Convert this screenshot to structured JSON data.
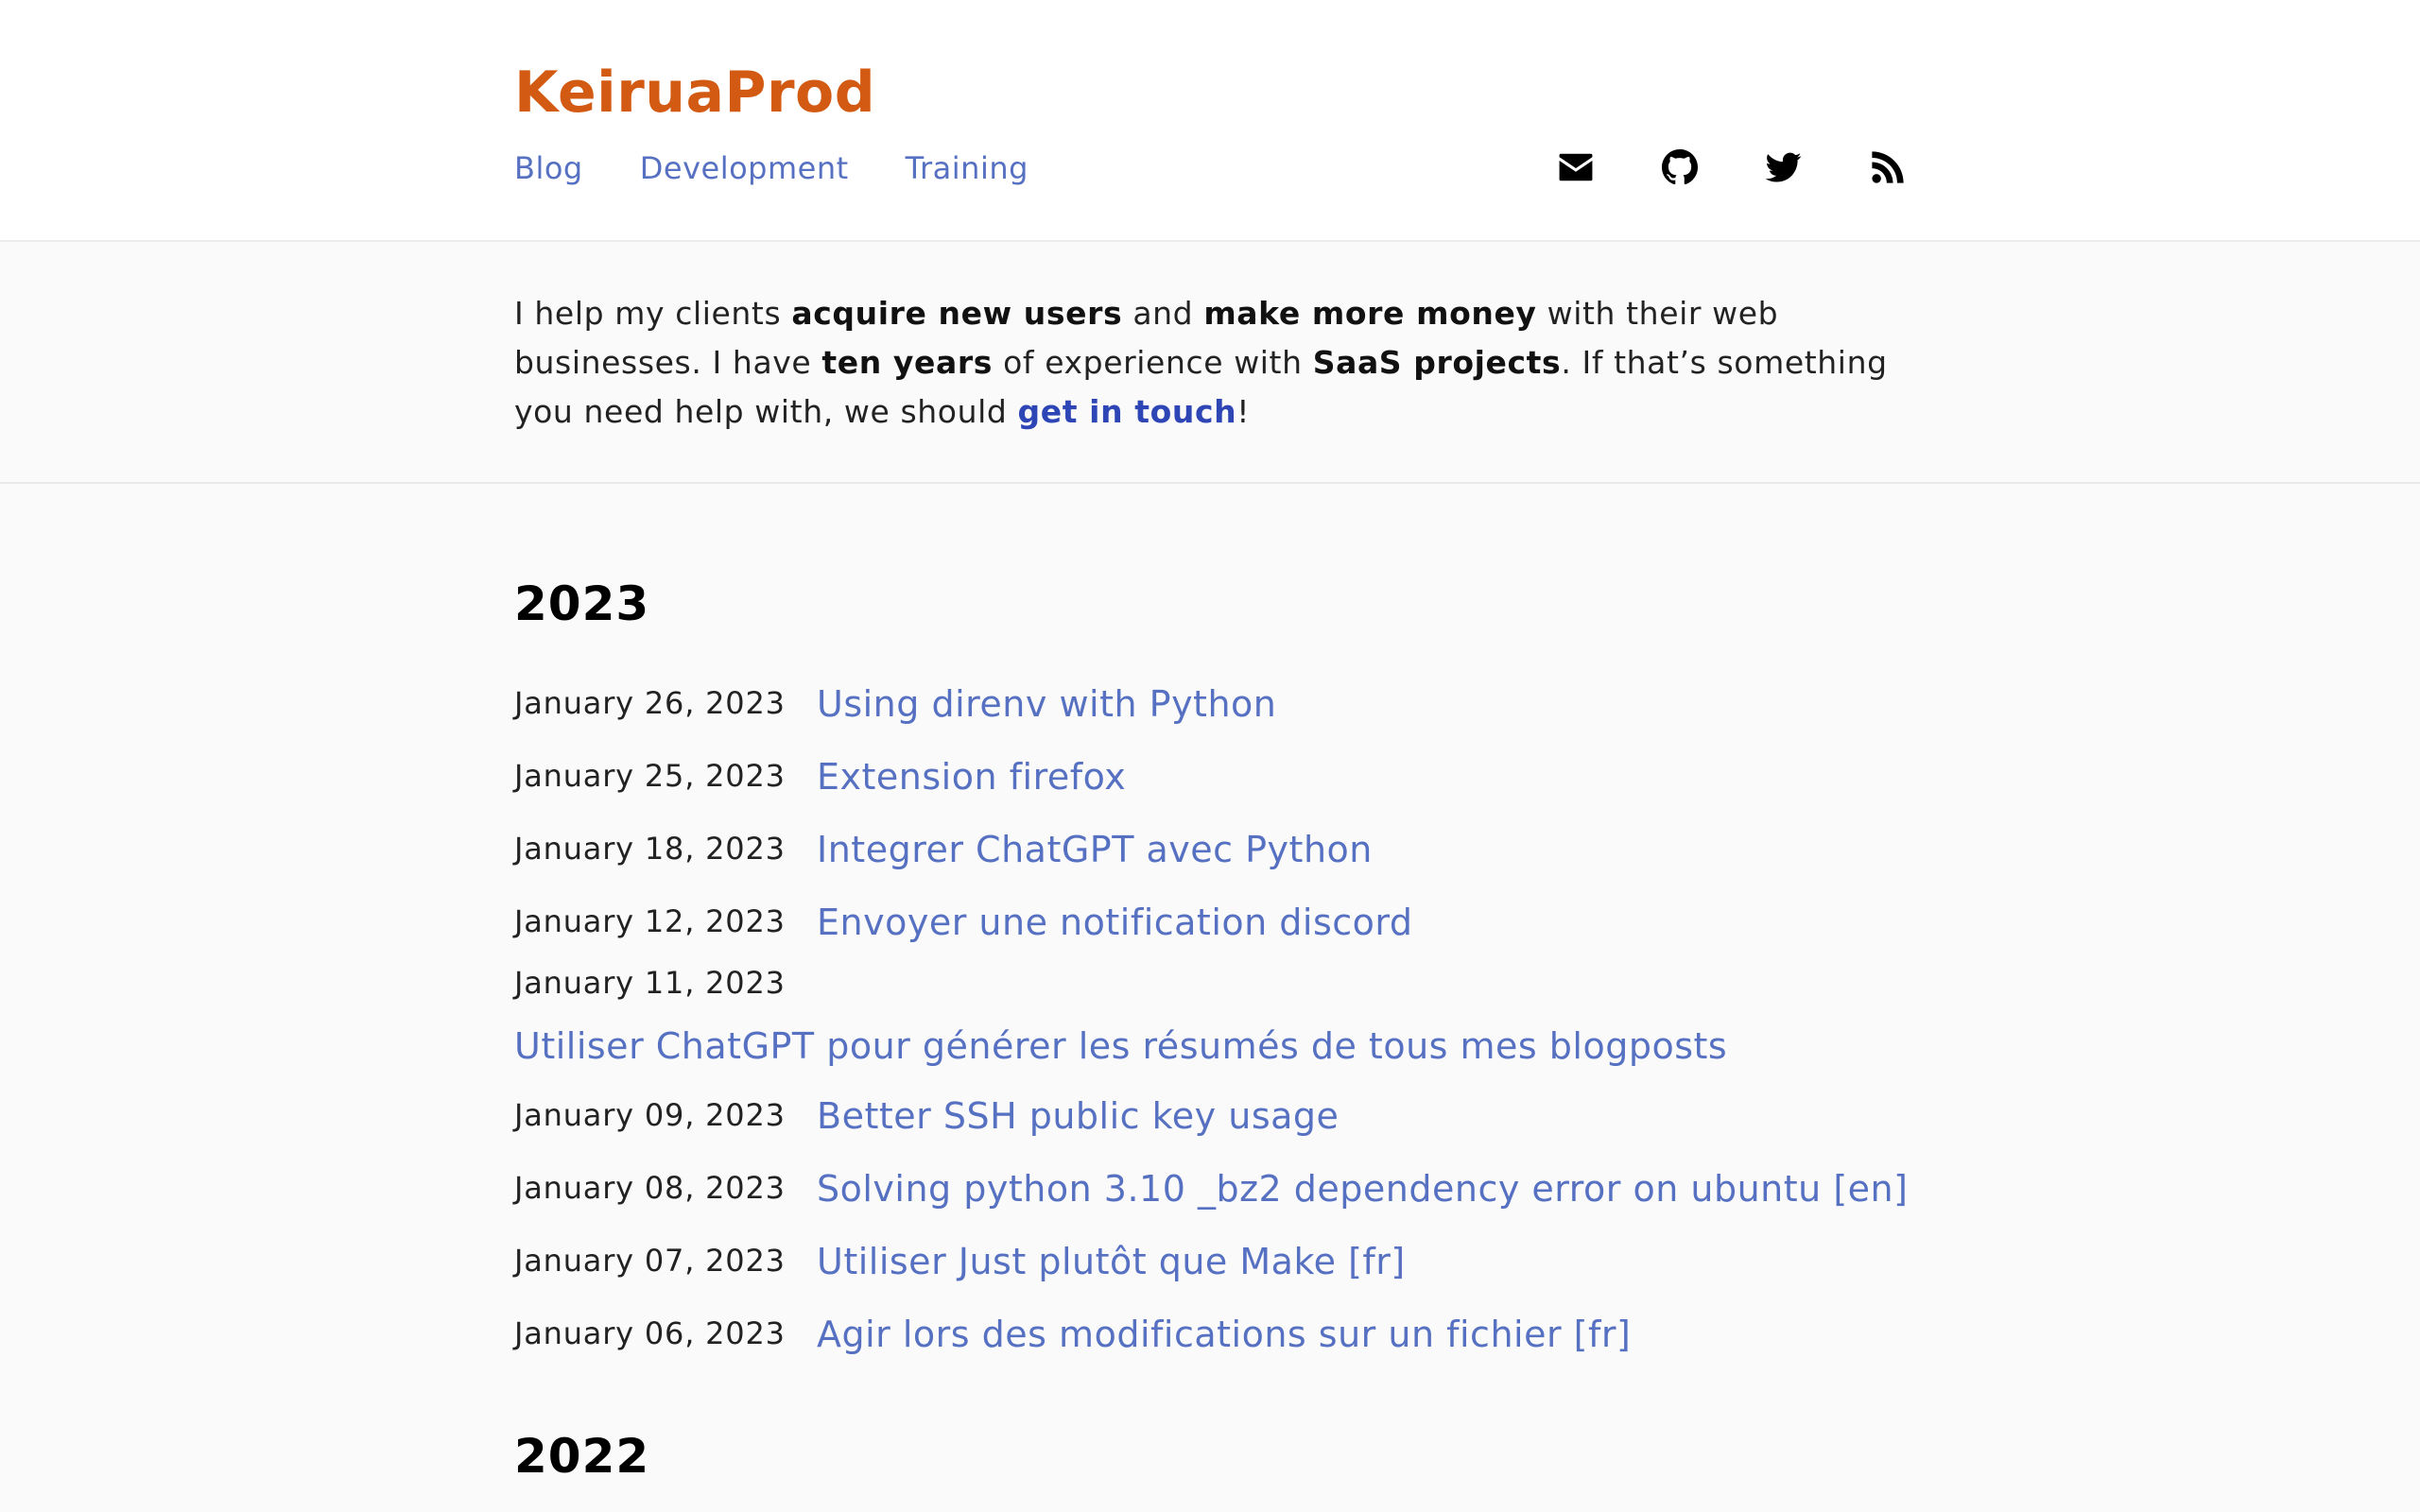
{
  "site": {
    "title": "KeiruaProd"
  },
  "nav": [
    {
      "label": "Blog"
    },
    {
      "label": "Development"
    },
    {
      "label": "Training"
    }
  ],
  "social": [
    {
      "icon": "envelope-icon"
    },
    {
      "icon": "github-icon"
    },
    {
      "icon": "twitter-icon"
    },
    {
      "icon": "rss-icon"
    }
  ],
  "intro": {
    "t1": "I help my clients ",
    "b1": "acquire new users",
    "t2": " and ",
    "b2": "make more money",
    "t3": " with their web businesses. I have ",
    "b3": "ten years",
    "t4": " of experience with ",
    "b4": "SaaS projects",
    "t5": ". If that’s something you need help with, we should ",
    "link": "get in touch",
    "t6": "!"
  },
  "years": [
    {
      "year": "2023",
      "posts": [
        {
          "date": "January 26, 2023",
          "title": "Using direnv with Python"
        },
        {
          "date": "January 25, 2023",
          "title": "Extension firefox"
        },
        {
          "date": "January 18, 2023",
          "title": "Integrer ChatGPT avec Python"
        },
        {
          "date": "January 12, 2023",
          "title": "Envoyer une notification discord"
        },
        {
          "date": "January 11, 2023",
          "title": "Utiliser ChatGPT pour générer les résumés de tous mes blogposts"
        },
        {
          "date": "January 09, 2023",
          "title": "Better SSH public key usage"
        },
        {
          "date": "January 08, 2023",
          "title": "Solving python 3.10 _bz2 dependency error on ubuntu [en]"
        },
        {
          "date": "January 07, 2023",
          "title": "Utiliser Just plutôt que Make [fr]"
        },
        {
          "date": "January 06, 2023",
          "title": "Agir lors des modifications sur un fichier [fr]"
        }
      ]
    },
    {
      "year": "2022",
      "posts": []
    }
  ],
  "colors": {
    "brand": "#d35a12",
    "link": "#5670c2",
    "strong_link": "#2d45b5"
  }
}
